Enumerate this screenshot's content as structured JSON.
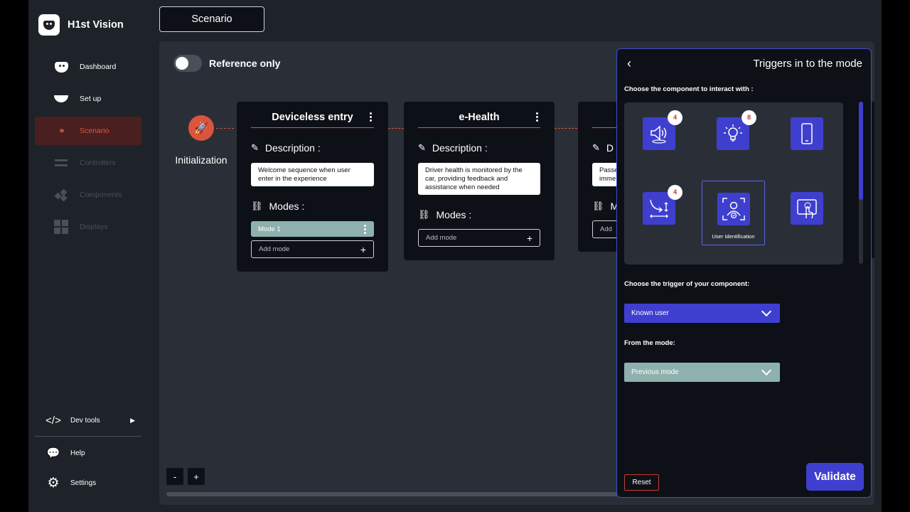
{
  "brand": {
    "name": "H1st Vision"
  },
  "nav": {
    "items": [
      {
        "label": "Dashboard"
      },
      {
        "label": "Set up"
      },
      {
        "label": "Scenario"
      },
      {
        "label": "Controllers"
      },
      {
        "label": "Components"
      },
      {
        "label": "Displays"
      }
    ],
    "bottom": [
      {
        "label": "Dev tools"
      },
      {
        "label": "Help"
      },
      {
        "label": "Settings"
      }
    ]
  },
  "header": {
    "tab": "Scenario"
  },
  "canvas": {
    "toggle_label": "Reference only",
    "toggle_on": false,
    "init_label": "Initialization",
    "zoom_out": "-",
    "zoom_in": "+"
  },
  "cards": [
    {
      "title": "Deviceless entry",
      "description_label": "Description :",
      "description": "Welcome sequence when user enter in the experience",
      "modes_label": "Modes :",
      "modes": [
        "Mode 1"
      ],
      "add_mode": "Add mode"
    },
    {
      "title": "e-Health",
      "description_label": "Description :",
      "description": "Driver health is monitored by the car, providing feedback and assistance when needed",
      "modes_label": "Modes :",
      "modes": [],
      "add_mode": "Add mode"
    },
    {
      "title": "",
      "description_label": "D",
      "description": "Passe imme",
      "modes_label": "M",
      "add_mode": "Add"
    }
  ],
  "panel": {
    "back": "‹",
    "title": "Triggers in to the mode",
    "component_label": "Choose the component to interact with :",
    "components": [
      {
        "icon": "speaker-icon",
        "badge": "4"
      },
      {
        "icon": "lightbulb-icon",
        "badge": "8"
      },
      {
        "icon": "smartphone-icon",
        "badge": ""
      },
      {
        "icon": "gesture-icon",
        "badge": "4"
      },
      {
        "icon": "user-identification-icon",
        "badge": "",
        "label": "User Identification",
        "selected": true
      },
      {
        "icon": "touch-screen-icon",
        "badge": ""
      }
    ],
    "trigger_label": "Choose the trigger of your component:",
    "trigger_value": "Known user",
    "mode_label": "From the mode:",
    "mode_value": "Previous mode",
    "reset": "Reset",
    "validate": "Validate"
  },
  "colors": {
    "accent_red": "#d9553e",
    "accent_blue": "#3f3fcf",
    "teal": "#8fb1ad",
    "card_bg": "#0d1117",
    "canvas_bg": "#2a2f37"
  }
}
